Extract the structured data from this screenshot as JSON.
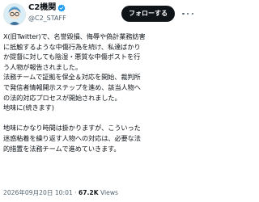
{
  "account": {
    "name": "C2機関",
    "handle": "@C2_STAFF",
    "verified": true,
    "avatar_icon": "glasses-character-avatar"
  },
  "actions": {
    "follow_label": "フォローする",
    "more_icon": "more-dots-icon"
  },
  "post": {
    "lines": [
      "X(旧Twitter)で、名誉毀損、侮辱や偽計業務妨害",
      "に抵触するような中傷行為を続け、私達ばかり",
      "か提督に対しても陰湿・悪質な中傷ポストを行",
      "う人物が報告されました。",
      "法務チームで証拠を保全＆対応を開始、裁判所",
      "で発信者情報開示ステップを進め、該当人物へ",
      "の法的対応プロセスが開始されました。",
      "地味に(続きます)",
      "地味にかなり時間は掛かりますが、こういった",
      "迷惑粘着を繰り返す人物への対応は、必要な法",
      "的措置を法務チームで進めていきます。"
    ]
  },
  "meta": {
    "timestamp": "2026年09月20日 10:01",
    "separator": " · ",
    "views_count": "67.2K",
    "views_label": " Views"
  }
}
